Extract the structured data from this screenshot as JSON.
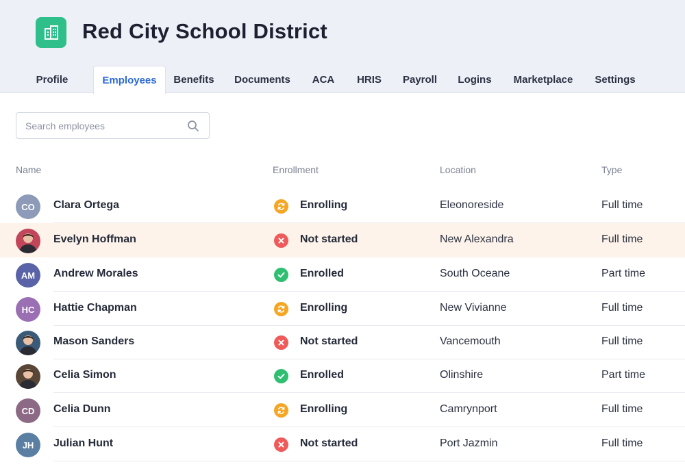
{
  "org": {
    "name": "Red City School District",
    "logo_icon": "building-icon",
    "logo_color": "#2fbf8a"
  },
  "tabs": [
    {
      "label": "Profile",
      "active": false
    },
    {
      "label": "Employees",
      "active": true
    },
    {
      "label": "Benefits",
      "active": false
    },
    {
      "label": "Documents",
      "active": false
    },
    {
      "label": "ACA",
      "active": false
    },
    {
      "label": "HRIS",
      "active": false
    },
    {
      "label": "Payroll",
      "active": false
    },
    {
      "label": "Logins",
      "active": false
    },
    {
      "label": "Marketplace",
      "active": false
    },
    {
      "label": "Settings",
      "active": false
    }
  ],
  "search": {
    "placeholder": "Search employees",
    "value": "",
    "icon": "search-icon"
  },
  "table": {
    "columns": {
      "name": "Name",
      "enrollment": "Enrollment",
      "location": "Location",
      "type": "Type"
    },
    "status_colors": {
      "Enrolling": "#f5a623",
      "Not started": "#ef5a5a",
      "Enrolled": "#2fbf71"
    },
    "rows": [
      {
        "name": "Clara Ortega",
        "initials": "CO",
        "avatar_color": "#8d9ab8",
        "avatar_photo": false,
        "enrollment": "Enrolling",
        "location": "Eleonoreside",
        "type": "Full time",
        "highlight": false
      },
      {
        "name": "Evelyn Hoffman",
        "initials": "",
        "avatar_color": "#c2455a",
        "avatar_photo": true,
        "enrollment": "Not started",
        "location": "New Alexandra",
        "type": "Full time",
        "highlight": true
      },
      {
        "name": "Andrew Morales",
        "initials": "AM",
        "avatar_color": "#5a63a8",
        "avatar_photo": false,
        "enrollment": "Enrolled",
        "location": "South Oceane",
        "type": "Part time",
        "highlight": false
      },
      {
        "name": "Hattie Chapman",
        "initials": "HC",
        "avatar_color": "#9b6fb3",
        "avatar_photo": false,
        "enrollment": "Enrolling",
        "location": "New Vivianne",
        "type": "Full time",
        "highlight": false
      },
      {
        "name": "Mason Sanders",
        "initials": "",
        "avatar_color": "#3a5a78",
        "avatar_photo": true,
        "enrollment": "Not started",
        "location": "Vancemouth",
        "type": "Full time",
        "highlight": false
      },
      {
        "name": "Celia Simon",
        "initials": "",
        "avatar_color": "#5a4636",
        "avatar_photo": true,
        "enrollment": "Enrolled",
        "location": "Olinshire",
        "type": "Part time",
        "highlight": false
      },
      {
        "name": "Celia Dunn",
        "initials": "CD",
        "avatar_color": "#8c6a86",
        "avatar_photo": false,
        "enrollment": "Enrolling",
        "location": "Camrynport",
        "type": "Full time",
        "highlight": false
      },
      {
        "name": "Julian Hunt",
        "initials": "JH",
        "avatar_color": "#5a7fa3",
        "avatar_photo": false,
        "enrollment": "Not started",
        "location": "Port Jazmin",
        "type": "Full time",
        "highlight": false
      }
    ]
  }
}
